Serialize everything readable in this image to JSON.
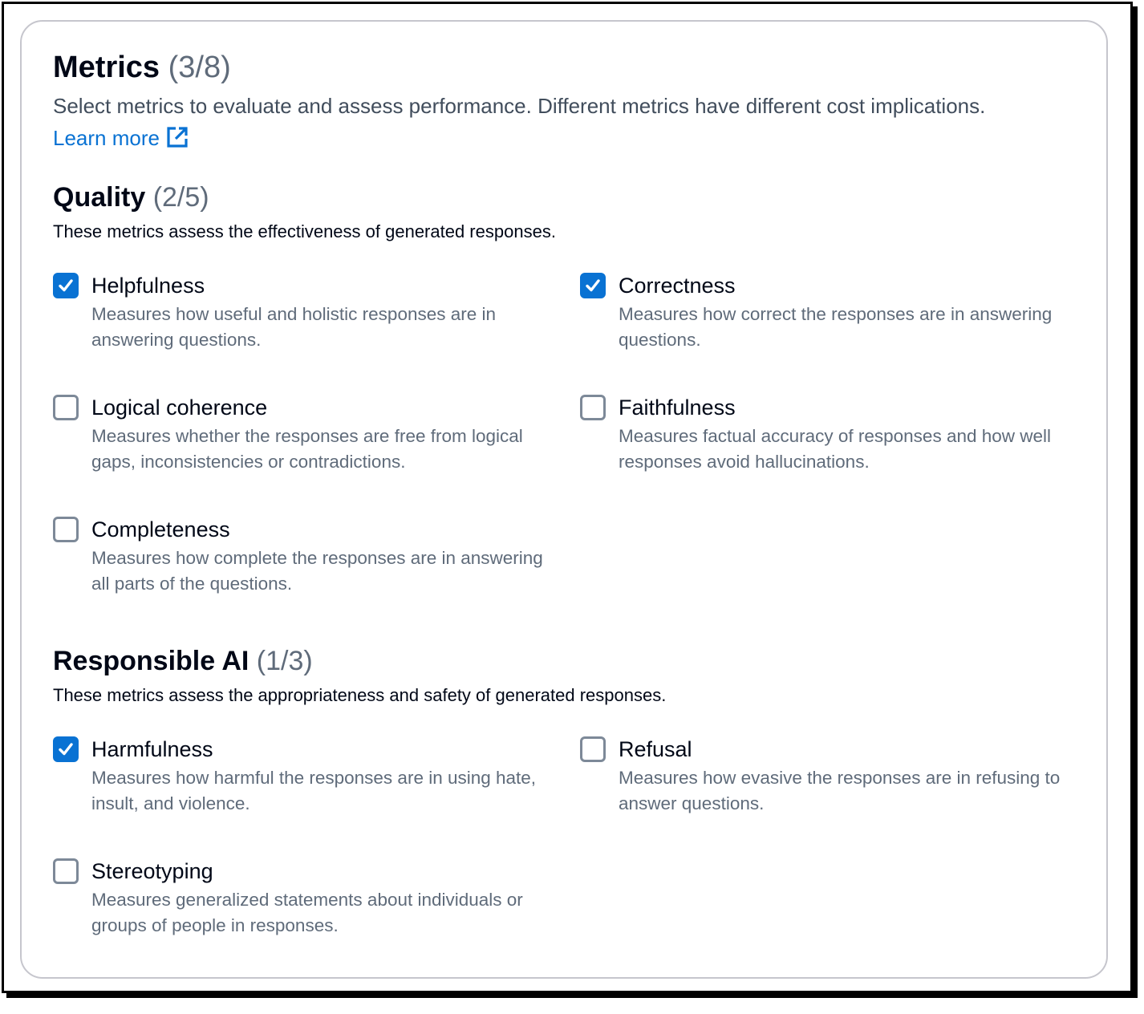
{
  "header": {
    "title": "Metrics",
    "count": "(3/8)",
    "description": "Select metrics to evaluate and assess performance. Different metrics have different cost implications.",
    "learn_more": "Learn more"
  },
  "sections": [
    {
      "title": "Quality",
      "count": "(2/5)",
      "description": "These metrics assess the effectiveness of generated responses.",
      "metrics": [
        {
          "label": "Helpfulness",
          "description": "Measures how useful and holistic responses are in answering questions.",
          "checked": true
        },
        {
          "label": "Correctness",
          "description": "Measures how correct the responses are in answering questions.",
          "checked": true
        },
        {
          "label": "Logical coherence",
          "description": "Measures whether the responses are free from logical gaps, inconsistencies or contradictions.",
          "checked": false
        },
        {
          "label": "Faithfulness",
          "description": "Measures factual accuracy of responses and how well responses avoid hallucinations.",
          "checked": false
        },
        {
          "label": "Completeness",
          "description": "Measures how complete the responses are in answering all parts of the questions.",
          "checked": false
        }
      ]
    },
    {
      "title": "Responsible AI",
      "count": "(1/3)",
      "description": "These metrics assess the appropriateness and safety of generated responses.",
      "metrics": [
        {
          "label": "Harmfulness",
          "description": "Measures how harmful the responses are in using hate, insult, and violence.",
          "checked": true
        },
        {
          "label": "Refusal",
          "description": "Measures how evasive the responses are in refusing to answer questions.",
          "checked": false
        },
        {
          "label": "Stereotyping",
          "description": "Measures generalized statements about individuals or groups of people in responses.",
          "checked": false
        }
      ]
    }
  ],
  "colors": {
    "accent": "#0972d3",
    "heading": "#000716",
    "muted": "#5f6b7a"
  }
}
